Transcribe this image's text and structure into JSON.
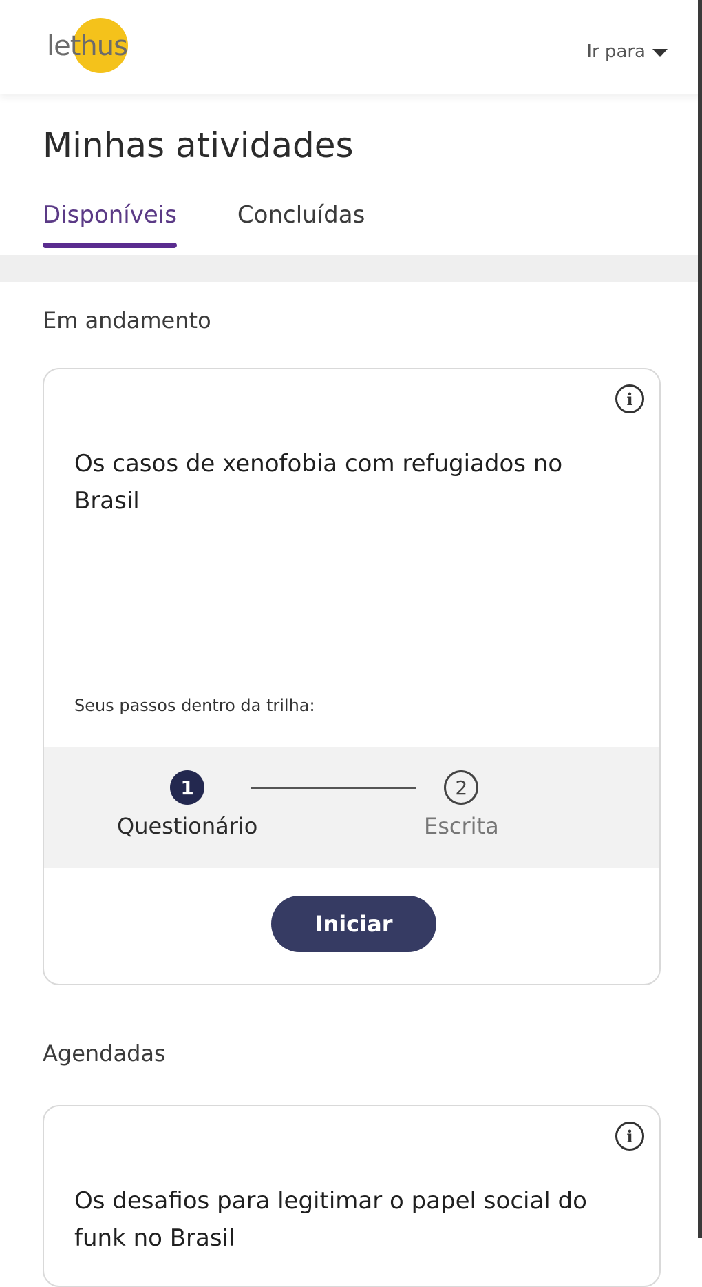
{
  "header": {
    "logo_text": "lethus",
    "goto_label": "Ir para"
  },
  "page": {
    "title": "Minhas atividades",
    "tabs": [
      {
        "label": "Disponíveis",
        "active": true
      },
      {
        "label": "Concluídas",
        "active": false
      }
    ]
  },
  "sections": {
    "in_progress": {
      "label": "Em andamento",
      "card": {
        "title": "Os casos de xenofobia com refugiados no Brasil",
        "steps_caption": "Seus passos dentro da trilha:",
        "steps": [
          {
            "number": "1",
            "label": "Questionário",
            "completed": true
          },
          {
            "number": "2",
            "label": "Escrita",
            "completed": false
          }
        ],
        "button_label": "Iniciar"
      }
    },
    "scheduled": {
      "label": "Agendadas",
      "card": {
        "title": "Os desafios para legitimar o papel social do funk no Brasil"
      }
    }
  },
  "colors": {
    "accent": "#5a2c8f",
    "logo_yellow": "#f4c21b",
    "primary_button": "#363b63",
    "step_done": "#23284f"
  }
}
